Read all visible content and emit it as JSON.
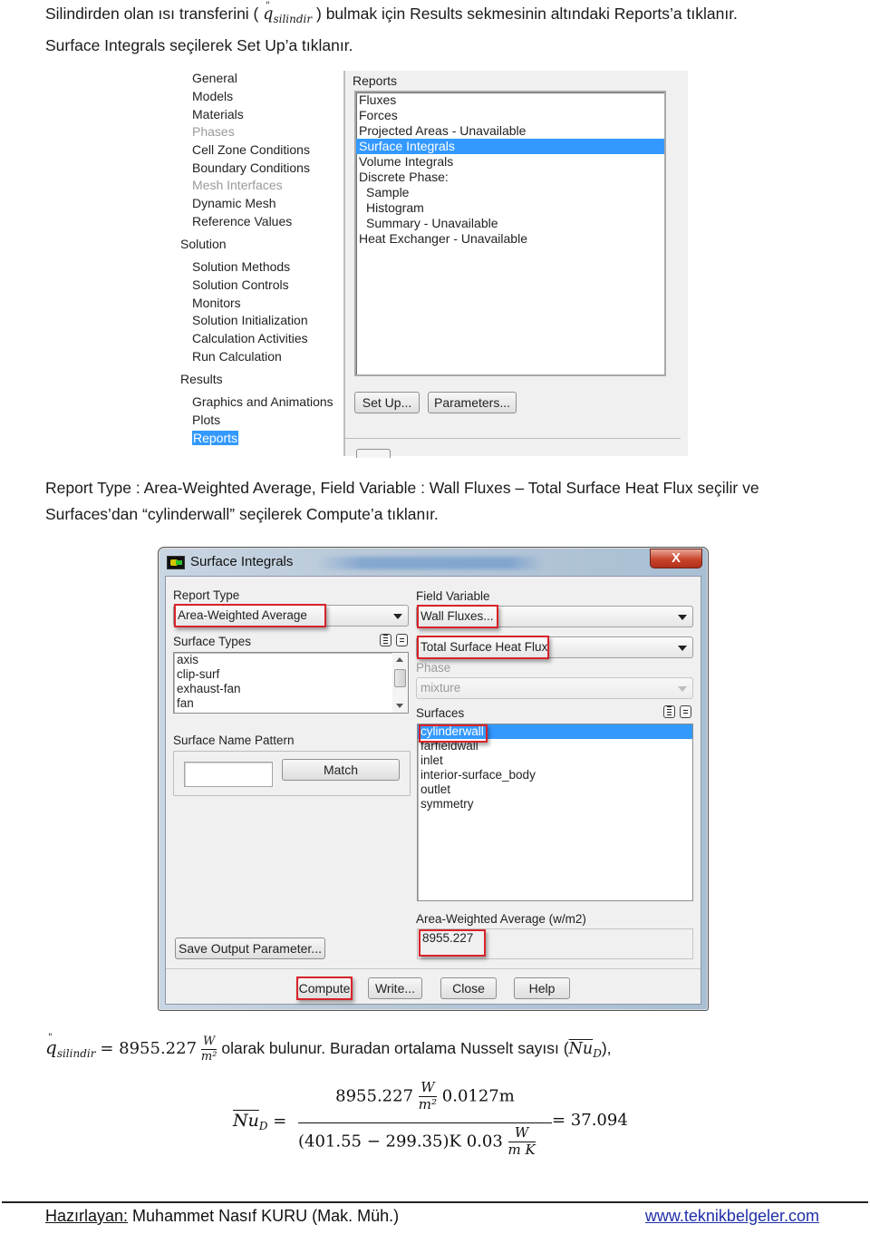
{
  "intro": {
    "line1_before": "Silindirden olan ısı transferini (",
    "q_symbol": "q",
    "q_sub": "silindir",
    "q_mark": "\"",
    "line1_after": ") bulmak için Results sekmesinin altındaki Reports’a tıklanır.",
    "line2": "Surface Integrals seçilerek Set Up’a tıklanır."
  },
  "navigation": {
    "items": [
      {
        "label": "General",
        "level": "sub",
        "state": "enabled"
      },
      {
        "label": "Models",
        "level": "sub",
        "state": "enabled"
      },
      {
        "label": "Materials",
        "level": "sub",
        "state": "enabled"
      },
      {
        "label": "Phases",
        "level": "sub",
        "state": "disabled"
      },
      {
        "label": "Cell Zone Conditions",
        "level": "sub",
        "state": "enabled"
      },
      {
        "label": "Boundary Conditions",
        "level": "sub",
        "state": "enabled"
      },
      {
        "label": "Mesh Interfaces",
        "level": "sub",
        "state": "disabled"
      },
      {
        "label": "Dynamic Mesh",
        "level": "sub",
        "state": "enabled"
      },
      {
        "label": "Reference Values",
        "level": "sub",
        "state": "enabled"
      },
      {
        "label": "Solution",
        "level": "head",
        "state": "enabled"
      },
      {
        "label": "Solution Methods",
        "level": "sub",
        "state": "enabled"
      },
      {
        "label": "Solution Controls",
        "level": "sub",
        "state": "enabled"
      },
      {
        "label": "Monitors",
        "level": "sub",
        "state": "enabled"
      },
      {
        "label": "Solution Initialization",
        "level": "sub",
        "state": "enabled"
      },
      {
        "label": "Calculation Activities",
        "level": "sub",
        "state": "enabled"
      },
      {
        "label": "Run Calculation",
        "level": "sub",
        "state": "enabled"
      },
      {
        "label": "Results",
        "level": "head",
        "state": "enabled"
      },
      {
        "label": "Graphics and Animations",
        "level": "sub",
        "state": "enabled"
      },
      {
        "label": "Plots",
        "level": "sub",
        "state": "enabled"
      },
      {
        "label": "Reports",
        "level": "sub",
        "state": "selected"
      }
    ]
  },
  "reports_panel": {
    "label": "Reports",
    "items": [
      {
        "label": "Fluxes",
        "indent": false,
        "selected": false
      },
      {
        "label": "Forces",
        "indent": false,
        "selected": false
      },
      {
        "label": "Projected Areas - Unavailable",
        "indent": false,
        "selected": false
      },
      {
        "label": "Surface Integrals",
        "indent": false,
        "selected": true
      },
      {
        "label": "Volume Integrals",
        "indent": false,
        "selected": false
      },
      {
        "label": "Discrete Phase:",
        "indent": false,
        "selected": false
      },
      {
        "label": "Sample",
        "indent": true,
        "selected": false
      },
      {
        "label": "Histogram",
        "indent": true,
        "selected": false
      },
      {
        "label": "Summary - Unavailable",
        "indent": true,
        "selected": false
      },
      {
        "label": "Heat Exchanger - Unavailable",
        "indent": false,
        "selected": false
      }
    ],
    "setup_button": "Set Up...",
    "parameters_button": "Parameters..."
  },
  "instruction2": {
    "line1": "Report Type : Area-Weighted Average, Field Variable : Wall Fluxes – Total Surface Heat Flux seçilir ve",
    "line2": "Surfaces’dan “cylinderwall” seçilerek Compute’a tıklanır."
  },
  "dialog": {
    "title": "Surface Integrals",
    "close_label": "X",
    "report_type_label": "Report Type",
    "report_type_value": "Area-Weighted Average",
    "field_variable_label": "Field Variable",
    "field_variable_value": "Wall Fluxes...",
    "field_variable_sub_value": "Total Surface Heat Flux",
    "surface_types_label": "Surface Types",
    "surface_types": [
      "axis",
      "clip-surf",
      "exhaust-fan",
      "fan"
    ],
    "phase_label": "Phase",
    "phase_value": "mixture",
    "surfaces_label": "Surfaces",
    "surfaces": [
      {
        "label": "cylinderwall",
        "selected": true
      },
      {
        "label": "farfieldwall",
        "selected": false
      },
      {
        "label": "inlet",
        "selected": false
      },
      {
        "label": "interior-surface_body",
        "selected": false
      },
      {
        "label": "outlet",
        "selected": false
      },
      {
        "label": "symmetry",
        "selected": false
      }
    ],
    "surface_name_pattern_label": "Surface Name Pattern",
    "surface_name_pattern_value": "",
    "match_button": "Match",
    "result_label": "Area-Weighted Average (w/m2)",
    "result_value": "8955.227",
    "save_output_button": "Save Output Parameter...",
    "compute_button": "Compute",
    "write_button": "Write...",
    "close_button": "Close",
    "help_button": "Help",
    "highlight_color": "#d8232a",
    "selection_color": "#3399ff"
  },
  "result_sentence": {
    "q_symbol": "q",
    "q_sub": "silindir",
    "equals": "= 8955.227",
    "unit_num": "W",
    "unit_den": "m²",
    "text": "olarak bulunur. Buradan ortalama Nusselt sayısı (",
    "nu": "Nu",
    "nu_sub": "D",
    "text_end": "),"
  },
  "nusselt_equation": {
    "lhs": "Nu",
    "lhs_sub": "D",
    "num_value": "8955.227",
    "num_unit_num": "W",
    "num_unit_den": "m²",
    "num_length": "0.0127m",
    "den_temp": "(401.55 − 299.35)K 0.03",
    "den_unit_num": "W",
    "den_unit_den": "m K",
    "result": "= 37.094"
  },
  "footer": {
    "author_label": "Hazırlayan:",
    "author": " Muhammet Nasıf KURU (Mak. Müh.)",
    "website": "www.teknikbelgeler.com"
  }
}
